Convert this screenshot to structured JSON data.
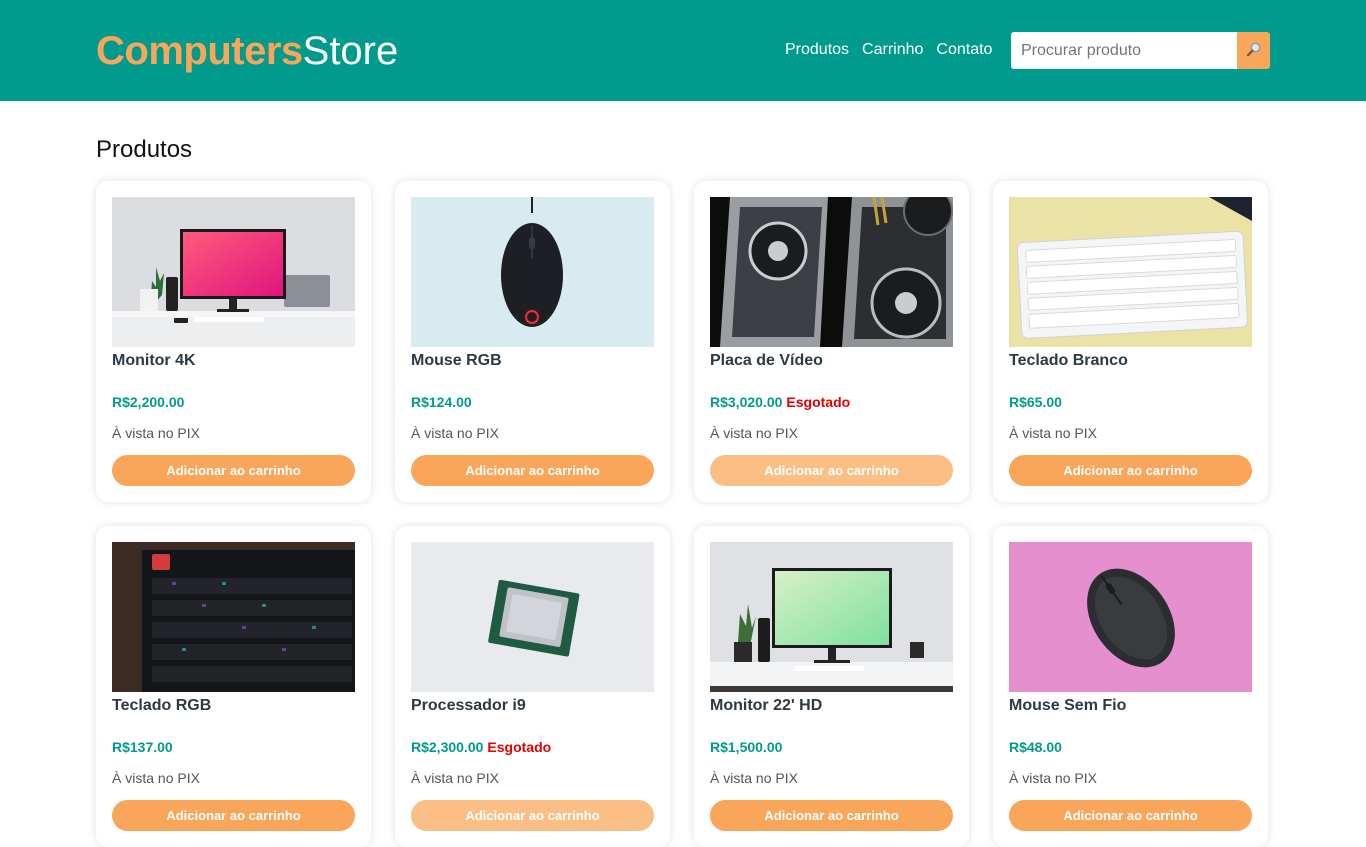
{
  "header": {
    "logo_accent": "Computers",
    "logo_rest": "Store",
    "nav": [
      "Produtos",
      "Carrinho",
      "Contato"
    ],
    "search_placeholder": "Procurar produto",
    "colors": {
      "primary": "#009b8c",
      "accent": "#f9a55a"
    }
  },
  "section_title": "Produtos",
  "products": [
    {
      "name": "Monitor 4K",
      "price": "R$2,200.00",
      "soldout": "",
      "pix": "À vista no PIX",
      "button": "Adicionar ao carrinho",
      "image": "monitor-pink-desk"
    },
    {
      "name": "Mouse RGB",
      "price": "R$124.00",
      "soldout": "",
      "pix": "À vista no PIX",
      "button": "Adicionar ao carrinho",
      "image": "black-gaming-mouse"
    },
    {
      "name": "Placa de Vídeo",
      "price": "R$3,020.00",
      "soldout": "Esgotado",
      "pix": "À vista no PIX",
      "button": "Adicionar ao carrinho",
      "image": "graphics-cards"
    },
    {
      "name": "Teclado Branco",
      "price": "R$65.00",
      "soldout": "",
      "pix": "À vista no PIX",
      "button": "Adicionar ao carrinho",
      "image": "white-keyboard"
    },
    {
      "name": "Teclado RGB",
      "price": "R$137.00",
      "soldout": "",
      "pix": "À vista no PIX",
      "button": "Adicionar ao carrinho",
      "image": "rgb-keyboard"
    },
    {
      "name": "Processador i9",
      "price": "R$2,300.00",
      "soldout": "Esgotado",
      "pix": "À vista no PIX",
      "button": "Adicionar ao carrinho",
      "image": "cpu-chip"
    },
    {
      "name": "Monitor 22' HD",
      "price": "R$1,500.00",
      "soldout": "",
      "pix": "À vista no PIX",
      "button": "Adicionar ao carrinho",
      "image": "monitor-green-desk"
    },
    {
      "name": "Mouse Sem Fio",
      "price": "R$48.00",
      "soldout": "",
      "pix": "À vista no PIX",
      "button": "Adicionar ao carrinho",
      "image": "wireless-mouse-pink"
    }
  ]
}
